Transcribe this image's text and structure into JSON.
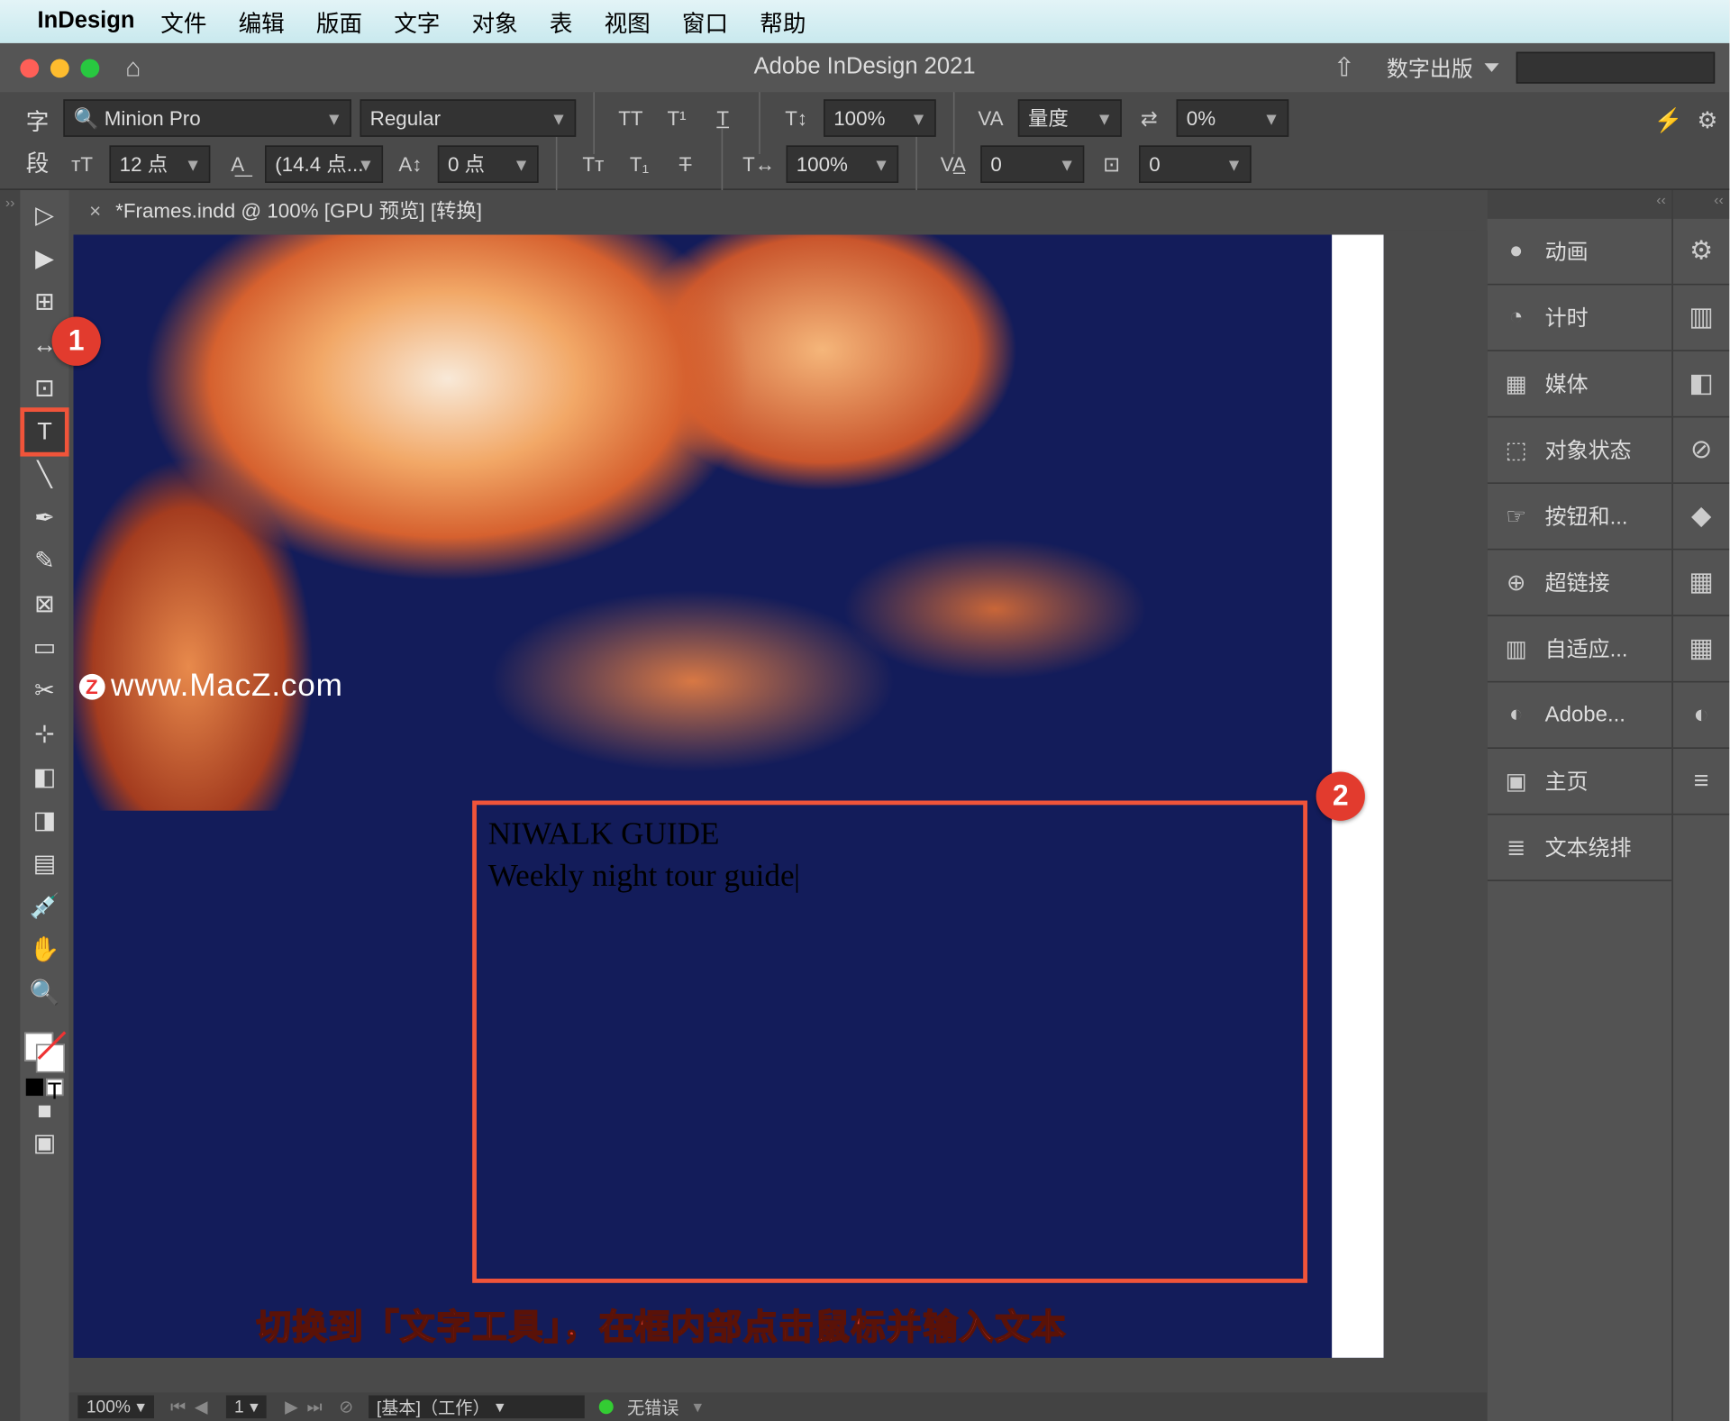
{
  "mac_menu": {
    "app": "InDesign",
    "items": [
      "文件",
      "编辑",
      "版面",
      "文字",
      "对象",
      "表",
      "视图",
      "窗口",
      "帮助"
    ]
  },
  "window": {
    "title": "Adobe InDesign 2021",
    "workspace": "数字出版"
  },
  "control": {
    "char_label": "字",
    "para_label": "段",
    "font": "Minion Pro",
    "style": "Regular",
    "size": "12 点",
    "leading": "(14.4 点...",
    "tracking": "0 点",
    "vscale": "100%",
    "hscale": "100%",
    "kerning_label": "量度",
    "kerning_val": "0",
    "baseline": "0%",
    "shift": "0"
  },
  "document": {
    "tab": "*Frames.indd @ 100% [GPU 预览] [转换]",
    "watermark": "www.MacZ.com",
    "frame_line1": "NIWALK GUIDE",
    "frame_line2": "Weekly night tour guide"
  },
  "caption": "切换到「文字工具」，在框内部点击鼠标并输入文本",
  "badges": {
    "b1": "1",
    "b2": "2"
  },
  "status": {
    "zoom": "100%",
    "page": "1",
    "style": "[基本]（工作）",
    "errors": "无错误"
  },
  "panels": {
    "items": [
      {
        "icon": "●",
        "label": "动画"
      },
      {
        "icon": "◔",
        "label": "计时"
      },
      {
        "icon": "▦",
        "label": "媒体"
      },
      {
        "icon": "⬚",
        "label": "对象状态"
      },
      {
        "icon": "☞",
        "label": "按钮和..."
      },
      {
        "icon": "⊕",
        "label": "超链接"
      },
      {
        "icon": "▥",
        "label": "自适应..."
      },
      {
        "icon": "◐",
        "label": "Adobe..."
      },
      {
        "icon": "▣",
        "label": "主页"
      },
      {
        "icon": "≣",
        "label": "文本绕排"
      }
    ],
    "mini": [
      "⚙",
      "▥",
      "◧",
      "⊘",
      "◆",
      "▦",
      "▦",
      "◐",
      "≡"
    ]
  }
}
